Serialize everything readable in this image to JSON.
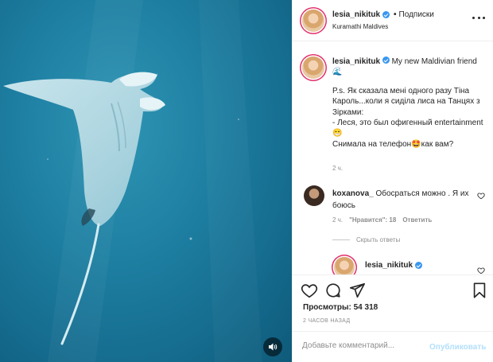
{
  "post": {
    "author": "lesia_nikituk",
    "follow_label": "Подписки",
    "location": "Kuramathi Maldives"
  },
  "caption": {
    "username": "lesia_nikituk",
    "line1": "My new Maldivian friend 🌊",
    "body": "P.s. Як сказала мені одного разу Тіна Кароль...коли я сиділа лиса на Танцях з Зірками:",
    "quote1": "- Леся, это был офигенный entertainment 😁",
    "quote2": "Снимала на телефон🤩как вам?",
    "time": "2 ч."
  },
  "comment": {
    "username": "koxanova_",
    "text": "Обосраться можно . Я их боюсь",
    "time": "2 ч.",
    "likes": "\"Нравится\": 18",
    "reply_label": "Ответить",
    "hide_replies": "Скрыть ответы"
  },
  "reply": {
    "username": "lesia_nikituk"
  },
  "stats": {
    "views": "Просмотры: 54 318",
    "posted": "2 часов назад"
  },
  "add_comment": {
    "placeholder": "Добавьте комментарий...",
    "publish": "Опубликовать"
  },
  "icons": [
    "heart-icon",
    "comment-icon",
    "share-icon",
    "bookmark-icon",
    "volume-icon",
    "more-options-icon",
    "verified-icon"
  ],
  "colors": {
    "accent": "#3897f0",
    "water": "#1e7fa2",
    "publish_disabled": "#b2dffc",
    "secondary_text": "#8e8e8e"
  }
}
